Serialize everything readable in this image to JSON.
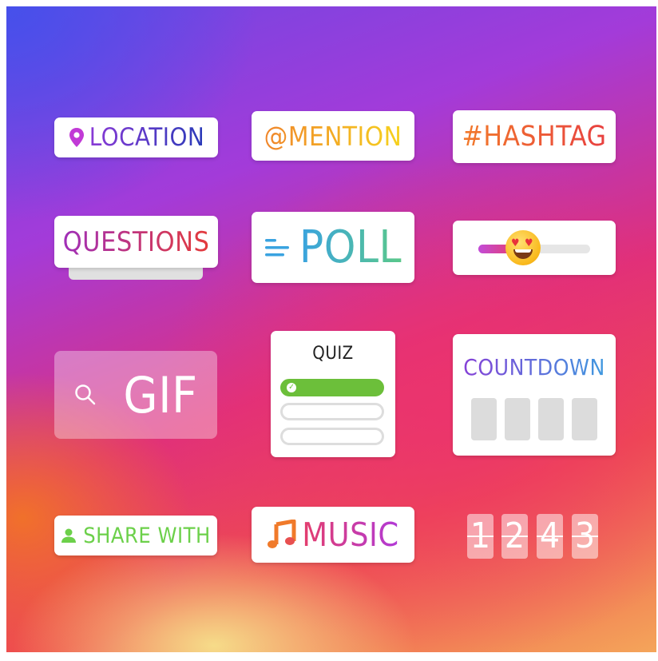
{
  "stickers": {
    "location": {
      "label": "LOCATION",
      "icon": "location-pin-icon"
    },
    "mention": {
      "label": "@MENTION"
    },
    "hashtag": {
      "label": "#HASHTAG"
    },
    "questions": {
      "label": "QUESTIONS"
    },
    "poll": {
      "label": "POLL",
      "icon": "poll-lines-icon"
    },
    "emoji_slider": {
      "emoji": "heart-eyes-emoji-icon",
      "level": 0.4
    },
    "gif": {
      "label": "GIF",
      "icon": "search-icon"
    },
    "quiz": {
      "title": "QUIZ"
    },
    "countdown": {
      "title": "COUNTDOWN"
    },
    "share_with": {
      "label": "SHARE WITH",
      "icon": "person-icon"
    },
    "music": {
      "label": "MUSIC",
      "icon": "music-note-icon"
    },
    "flip_counter": {
      "digits": [
        "1",
        "2",
        "4",
        "3"
      ]
    }
  },
  "colors": {
    "accent_purple": "#8a3ad6",
    "accent_orange": "#f07a2a",
    "accent_green": "#6cbf3a",
    "accent_red": "#e43b3b"
  }
}
